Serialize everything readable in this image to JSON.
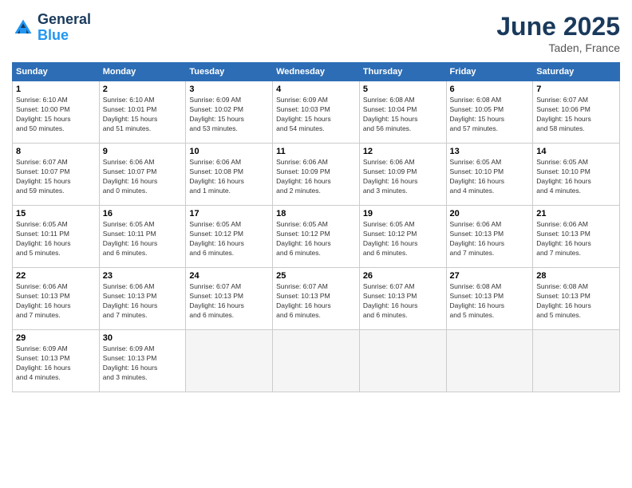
{
  "header": {
    "logo_line1": "General",
    "logo_line2": "Blue",
    "month_year": "June 2025",
    "location": "Taden, France"
  },
  "weekdays": [
    "Sunday",
    "Monday",
    "Tuesday",
    "Wednesday",
    "Thursday",
    "Friday",
    "Saturday"
  ],
  "weeks": [
    [
      {
        "day": "1",
        "info": "Sunrise: 6:10 AM\nSunset: 10:00 PM\nDaylight: 15 hours\nand 50 minutes."
      },
      {
        "day": "2",
        "info": "Sunrise: 6:10 AM\nSunset: 10:01 PM\nDaylight: 15 hours\nand 51 minutes."
      },
      {
        "day": "3",
        "info": "Sunrise: 6:09 AM\nSunset: 10:02 PM\nDaylight: 15 hours\nand 53 minutes."
      },
      {
        "day": "4",
        "info": "Sunrise: 6:09 AM\nSunset: 10:03 PM\nDaylight: 15 hours\nand 54 minutes."
      },
      {
        "day": "5",
        "info": "Sunrise: 6:08 AM\nSunset: 10:04 PM\nDaylight: 15 hours\nand 56 minutes."
      },
      {
        "day": "6",
        "info": "Sunrise: 6:08 AM\nSunset: 10:05 PM\nDaylight: 15 hours\nand 57 minutes."
      },
      {
        "day": "7",
        "info": "Sunrise: 6:07 AM\nSunset: 10:06 PM\nDaylight: 15 hours\nand 58 minutes."
      }
    ],
    [
      {
        "day": "8",
        "info": "Sunrise: 6:07 AM\nSunset: 10:07 PM\nDaylight: 15 hours\nand 59 minutes."
      },
      {
        "day": "9",
        "info": "Sunrise: 6:06 AM\nSunset: 10:07 PM\nDaylight: 16 hours\nand 0 minutes."
      },
      {
        "day": "10",
        "info": "Sunrise: 6:06 AM\nSunset: 10:08 PM\nDaylight: 16 hours\nand 1 minute."
      },
      {
        "day": "11",
        "info": "Sunrise: 6:06 AM\nSunset: 10:09 PM\nDaylight: 16 hours\nand 2 minutes."
      },
      {
        "day": "12",
        "info": "Sunrise: 6:06 AM\nSunset: 10:09 PM\nDaylight: 16 hours\nand 3 minutes."
      },
      {
        "day": "13",
        "info": "Sunrise: 6:05 AM\nSunset: 10:10 PM\nDaylight: 16 hours\nand 4 minutes."
      },
      {
        "day": "14",
        "info": "Sunrise: 6:05 AM\nSunset: 10:10 PM\nDaylight: 16 hours\nand 4 minutes."
      }
    ],
    [
      {
        "day": "15",
        "info": "Sunrise: 6:05 AM\nSunset: 10:11 PM\nDaylight: 16 hours\nand 5 minutes."
      },
      {
        "day": "16",
        "info": "Sunrise: 6:05 AM\nSunset: 10:11 PM\nDaylight: 16 hours\nand 6 minutes."
      },
      {
        "day": "17",
        "info": "Sunrise: 6:05 AM\nSunset: 10:12 PM\nDaylight: 16 hours\nand 6 minutes."
      },
      {
        "day": "18",
        "info": "Sunrise: 6:05 AM\nSunset: 10:12 PM\nDaylight: 16 hours\nand 6 minutes."
      },
      {
        "day": "19",
        "info": "Sunrise: 6:05 AM\nSunset: 10:12 PM\nDaylight: 16 hours\nand 6 minutes."
      },
      {
        "day": "20",
        "info": "Sunrise: 6:06 AM\nSunset: 10:13 PM\nDaylight: 16 hours\nand 7 minutes."
      },
      {
        "day": "21",
        "info": "Sunrise: 6:06 AM\nSunset: 10:13 PM\nDaylight: 16 hours\nand 7 minutes."
      }
    ],
    [
      {
        "day": "22",
        "info": "Sunrise: 6:06 AM\nSunset: 10:13 PM\nDaylight: 16 hours\nand 7 minutes."
      },
      {
        "day": "23",
        "info": "Sunrise: 6:06 AM\nSunset: 10:13 PM\nDaylight: 16 hours\nand 7 minutes."
      },
      {
        "day": "24",
        "info": "Sunrise: 6:07 AM\nSunset: 10:13 PM\nDaylight: 16 hours\nand 6 minutes."
      },
      {
        "day": "25",
        "info": "Sunrise: 6:07 AM\nSunset: 10:13 PM\nDaylight: 16 hours\nand 6 minutes."
      },
      {
        "day": "26",
        "info": "Sunrise: 6:07 AM\nSunset: 10:13 PM\nDaylight: 16 hours\nand 6 minutes."
      },
      {
        "day": "27",
        "info": "Sunrise: 6:08 AM\nSunset: 10:13 PM\nDaylight: 16 hours\nand 5 minutes."
      },
      {
        "day": "28",
        "info": "Sunrise: 6:08 AM\nSunset: 10:13 PM\nDaylight: 16 hours\nand 5 minutes."
      }
    ],
    [
      {
        "day": "29",
        "info": "Sunrise: 6:09 AM\nSunset: 10:13 PM\nDaylight: 16 hours\nand 4 minutes."
      },
      {
        "day": "30",
        "info": "Sunrise: 6:09 AM\nSunset: 10:13 PM\nDaylight: 16 hours\nand 3 minutes."
      },
      {
        "day": "",
        "info": ""
      },
      {
        "day": "",
        "info": ""
      },
      {
        "day": "",
        "info": ""
      },
      {
        "day": "",
        "info": ""
      },
      {
        "day": "",
        "info": ""
      }
    ]
  ]
}
